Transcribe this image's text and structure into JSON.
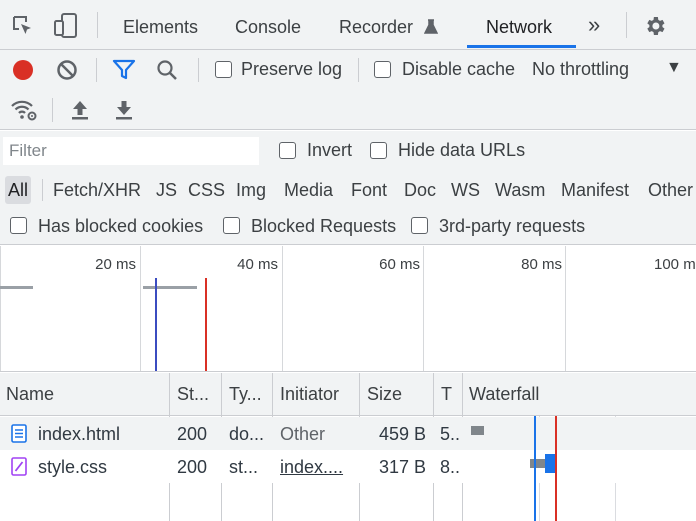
{
  "tabs": [
    {
      "label": "Elements"
    },
    {
      "label": "Console"
    },
    {
      "label": "Recorder"
    },
    {
      "label": "Network"
    }
  ],
  "active_tab": "Network",
  "more_tabs": "»",
  "toolbar": {
    "preserve_log": "Preserve log",
    "disable_cache": "Disable cache",
    "throttling": "No throttling",
    "throttling_arrow": "▼",
    "record_color": "#d93025"
  },
  "filter": {
    "placeholder": "Filter",
    "invert": "Invert",
    "hide_data_urls": "Hide data URLs"
  },
  "type_filters": [
    "All",
    "Fetch/XHR",
    "JS",
    "CSS",
    "Img",
    "Media",
    "Font",
    "Doc",
    "WS",
    "Wasm",
    "Manifest",
    "Other"
  ],
  "blocked": {
    "has_blocked_cookies": "Has blocked cookies",
    "blocked_requests": "Blocked Requests",
    "third_party": "3rd-party requests"
  },
  "overview": {
    "ticks": [
      "20 ms",
      "40 ms",
      "60 ms",
      "80 ms",
      "100 m"
    ],
    "dom_content_loaded_color": "#3b4cc0",
    "load_color": "#d93025"
  },
  "columns": {
    "name": "Name",
    "status": "St...",
    "type": "Ty...",
    "initiator": "Initiator",
    "size": "Size",
    "time": "T",
    "waterfall": "Waterfall"
  },
  "requests": [
    {
      "name": "index.html",
      "status": "200",
      "type": "do...",
      "initiator": "Other",
      "size": "459 B",
      "time": "5..",
      "icon": "document-icon"
    },
    {
      "name": "style.css",
      "status": "200",
      "type": "st...",
      "initiator": "index....",
      "size": "317 B",
      "time": "8..",
      "icon": "stylesheet-icon"
    }
  ]
}
